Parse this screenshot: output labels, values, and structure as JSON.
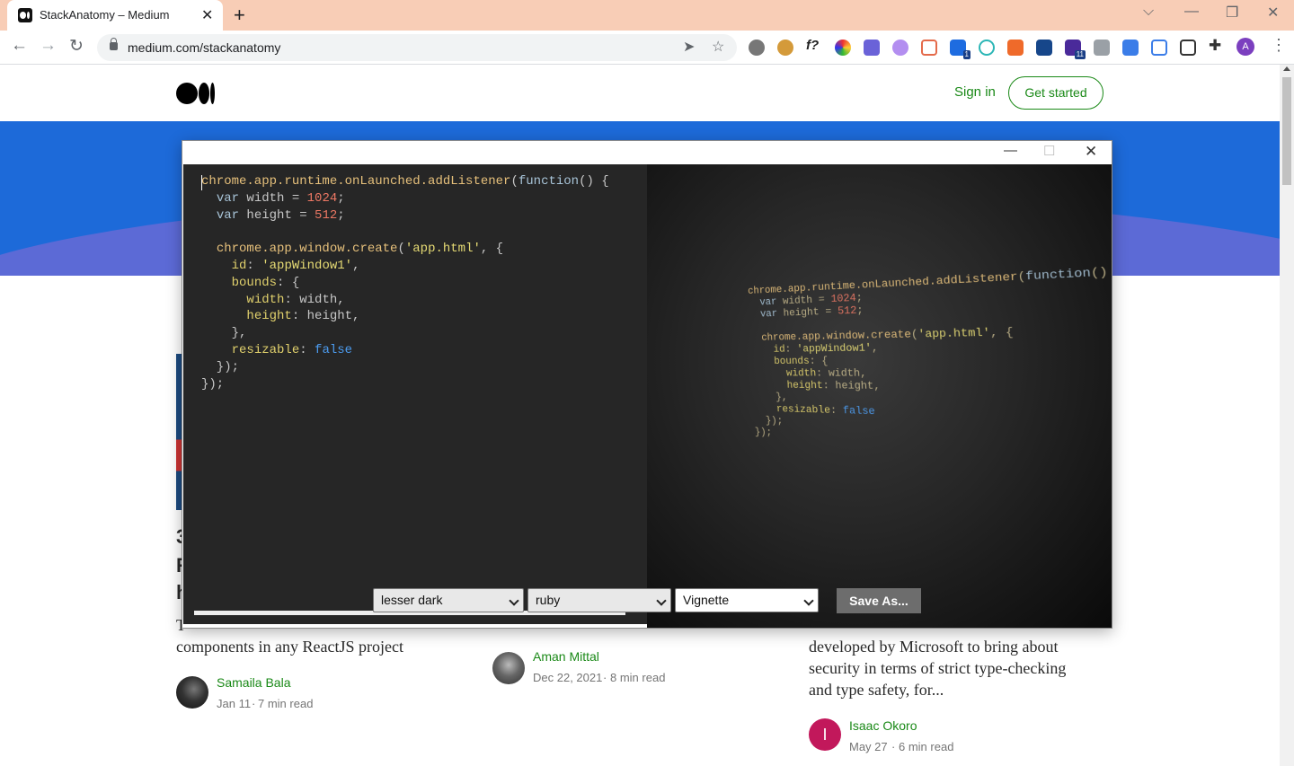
{
  "browser": {
    "tab_title": "StackAnatomy – Medium",
    "url": "medium.com/stackanatomy",
    "profile_initial": "A",
    "ext_badges": [
      "1",
      "11"
    ]
  },
  "site": {
    "sign_in": "Sign in",
    "get_started": "Get started"
  },
  "articles": [
    {
      "snippet_line1": "T",
      "snippet_line2": "components in any ReactJS project",
      "author": "Samaila Bala",
      "date": "Jan 11",
      "read_time": "7 min read",
      "title_frag": [
        "3",
        "R",
        "h"
      ]
    },
    {
      "author": "Aman Mittal",
      "date": "Dec 22, 2021",
      "read_time": "8 min read"
    },
    {
      "snippet_line1": "developed by Microsoft to bring about",
      "snippet_line2": "security in terms of strict type-checking",
      "snippet_line3": "and type safety, for...",
      "author": "Isaac Okoro",
      "date": "May 27",
      "read_time": "6 min read",
      "avatar_initial": "I"
    }
  ],
  "app": {
    "theme_select": "lesser dark",
    "language_select": "ruby",
    "effect_select": "Vignette",
    "save_label": "Save As...",
    "code_lines": [
      "chrome.app.runtime.onLaunched.addListener(function() {",
      "  var width = 1024;",
      "  var height = 512;",
      "",
      "  chrome.app.window.create('app.html', {",
      "    id: 'appWindow1',",
      "    bounds: {",
      "      width: width,",
      "      height: height,",
      "    },",
      "    resizable: false",
      "  });",
      "});"
    ]
  },
  "colors": {
    "medium_green": "#1a8917",
    "hero_blue": "#1d6ad9",
    "editor_bg": "#262626"
  }
}
